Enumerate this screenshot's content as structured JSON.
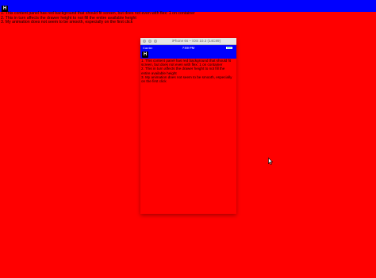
{
  "colors": {
    "background": "#ff0000",
    "bar": "#0000ff",
    "badge": "#000000"
  },
  "header": {
    "badge_label": "H"
  },
  "notes": [
    "1. This content panel has red background that should fit screen, but does not even with flex: 1 on container",
    "2. This in turn affects the drawer height to not fill the entire available height",
    "3. My animation does not seem to be smooth, especially on the first click"
  ],
  "simulator": {
    "title": "iPhone 6s – iOS 10.2 (14C89)",
    "status_bar": {
      "carrier": "Carrier",
      "time": "7:59 PM",
      "battery_icon": "battery-icon"
    },
    "nav_badge_label": "H",
    "notes": [
      "1. This content panel has red background that should fit screen, but does not even with flex: 1 on container",
      "2. This in turn affects the drawer height to not fill the entire available height",
      "3. My animation does not seem to be smooth, especially on the first click"
    ]
  },
  "cursor_icon": "mouse-pointer-icon"
}
